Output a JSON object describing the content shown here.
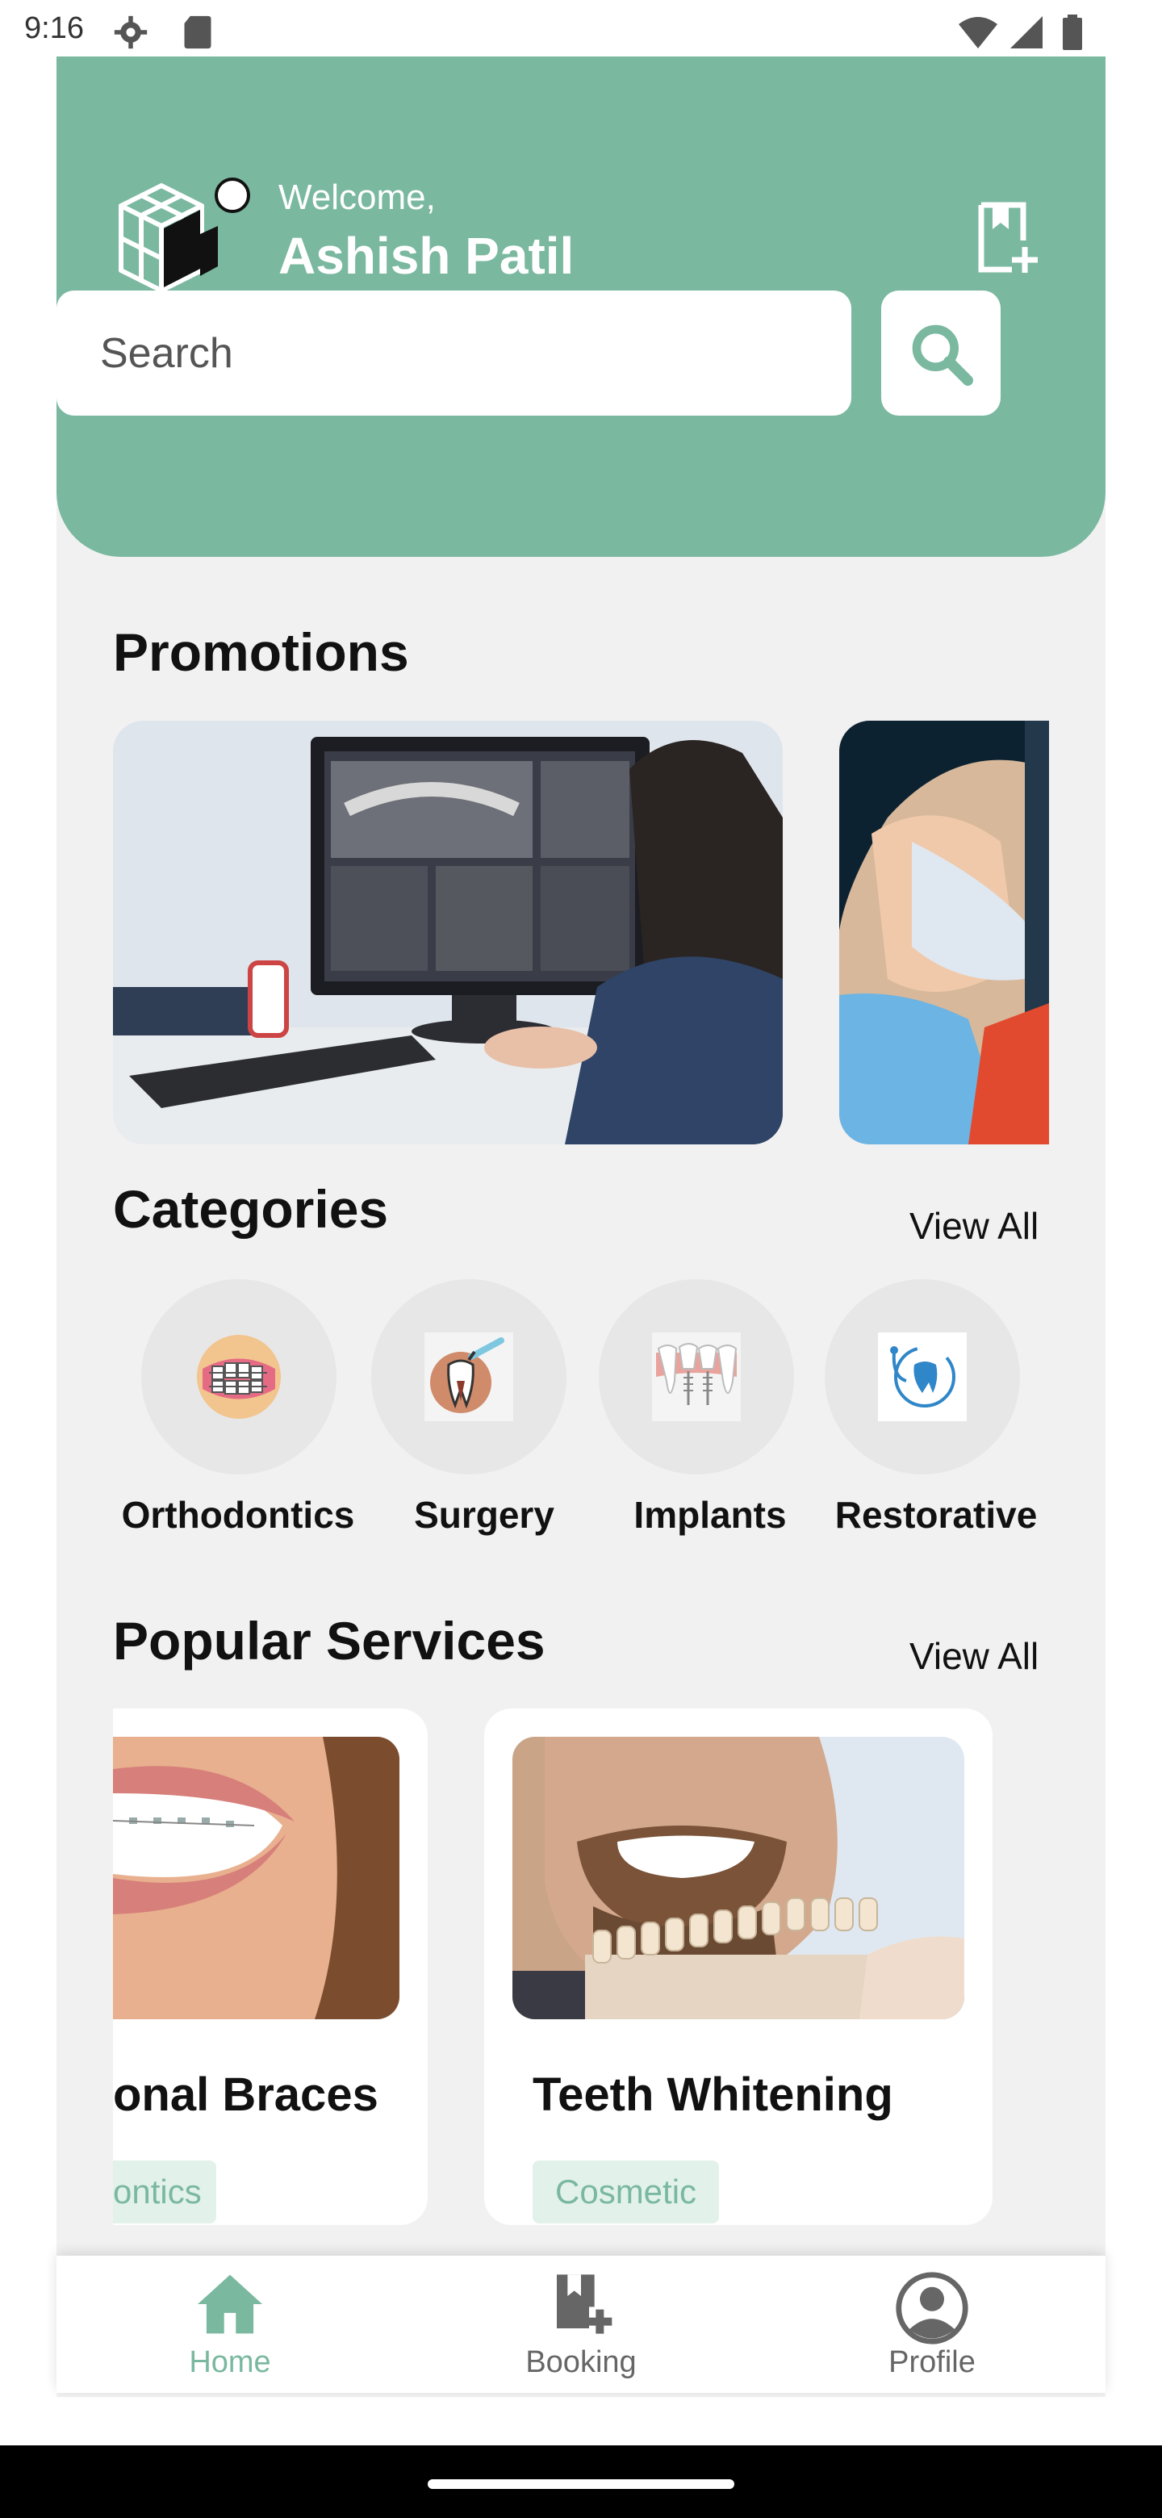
{
  "status_bar": {
    "time": "9:16"
  },
  "header": {
    "welcome": "Welcome,",
    "user_name": "Ashish Patil"
  },
  "search": {
    "placeholder": "Search"
  },
  "promotions": {
    "title": "Promotions"
  },
  "categories": {
    "title": "Categories",
    "view_all": "View All",
    "items": [
      {
        "label": "Orthodontics",
        "icon": "braces-icon"
      },
      {
        "label": "Surgery",
        "icon": "tooth-surgery-icon"
      },
      {
        "label": "Implants",
        "icon": "tooth-implant-icon"
      },
      {
        "label": "Restorative",
        "icon": "tooth-stethoscope-icon"
      }
    ]
  },
  "popular_services": {
    "title": "Popular Services",
    "view_all": "View All",
    "items": [
      {
        "title": "onal Braces",
        "tag": "ontics"
      },
      {
        "title": "Teeth Whitening",
        "tag": "Cosmetic"
      }
    ]
  },
  "bottom_nav": {
    "items": [
      {
        "label": "Home",
        "active": true
      },
      {
        "label": "Booking",
        "active": false
      },
      {
        "label": "Profile",
        "active": false
      }
    ]
  },
  "colors": {
    "accent": "#7ab8a0",
    "background": "#f1f1f1",
    "inactive": "#666666"
  }
}
